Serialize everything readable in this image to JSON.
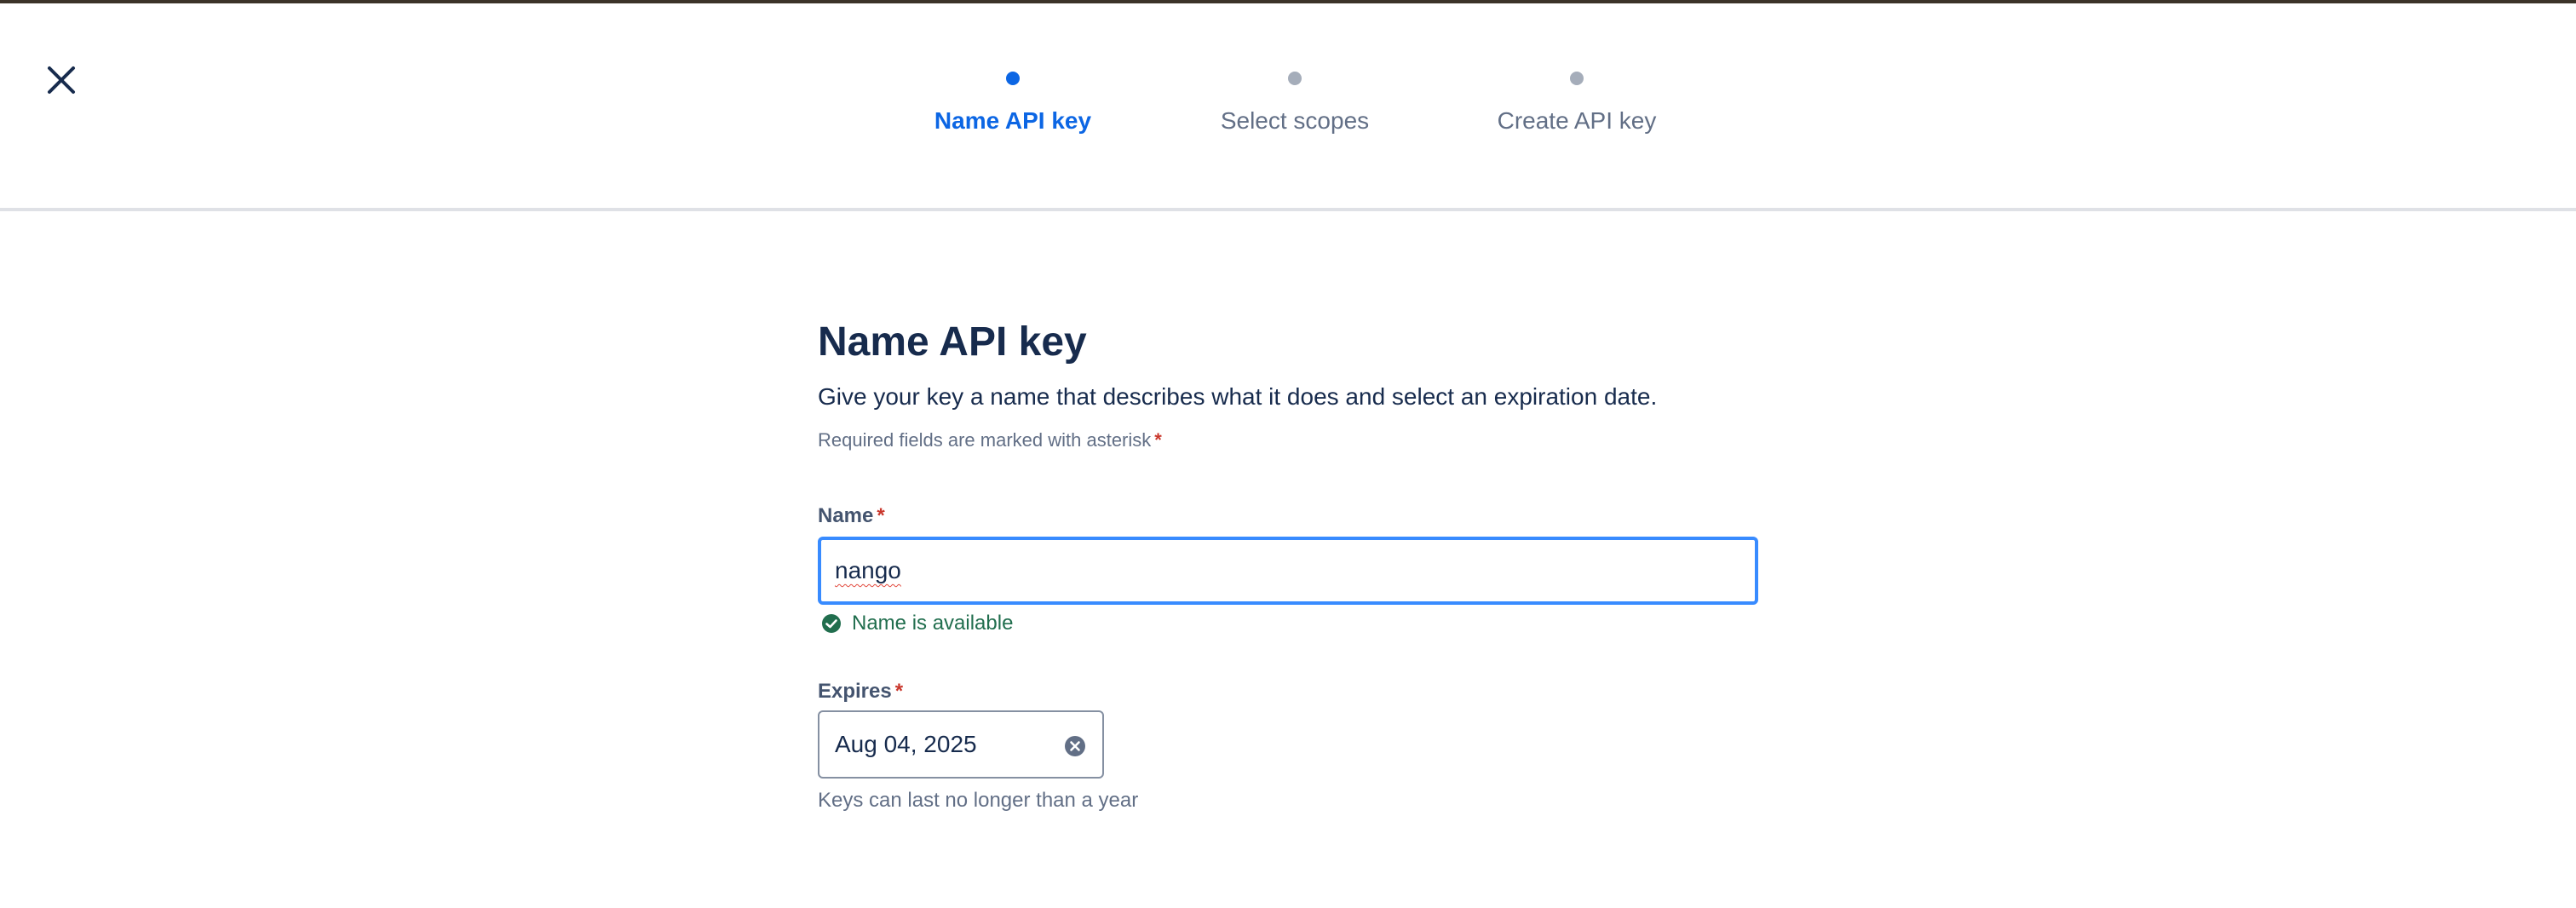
{
  "steps": [
    {
      "label": "Name API key",
      "state": "active"
    },
    {
      "label": "Select scopes",
      "state": "pending"
    },
    {
      "label": "Create API key",
      "state": "pending"
    }
  ],
  "header": {
    "close_icon": "close-icon"
  },
  "form": {
    "title": "Name API key",
    "description": "Give your key a name that describes what it does and select an expiration date.",
    "required_note": "Required fields are marked with asterisk",
    "required_marker": "*",
    "name": {
      "label": "Name",
      "value": "nango",
      "status_icon": "check-circle-icon",
      "status_text": "Name is available"
    },
    "expires": {
      "label": "Expires",
      "value": "Aug 04, 2025",
      "clear_icon": "clear-icon",
      "helper": "Keys can last no longer than a year"
    }
  },
  "colors": {
    "accent": "#0c66e4",
    "focus_border": "#388bff",
    "success": "#216e4e",
    "required": "#c9372c",
    "text": "#172b4d",
    "subtle_text": "#626f86"
  }
}
